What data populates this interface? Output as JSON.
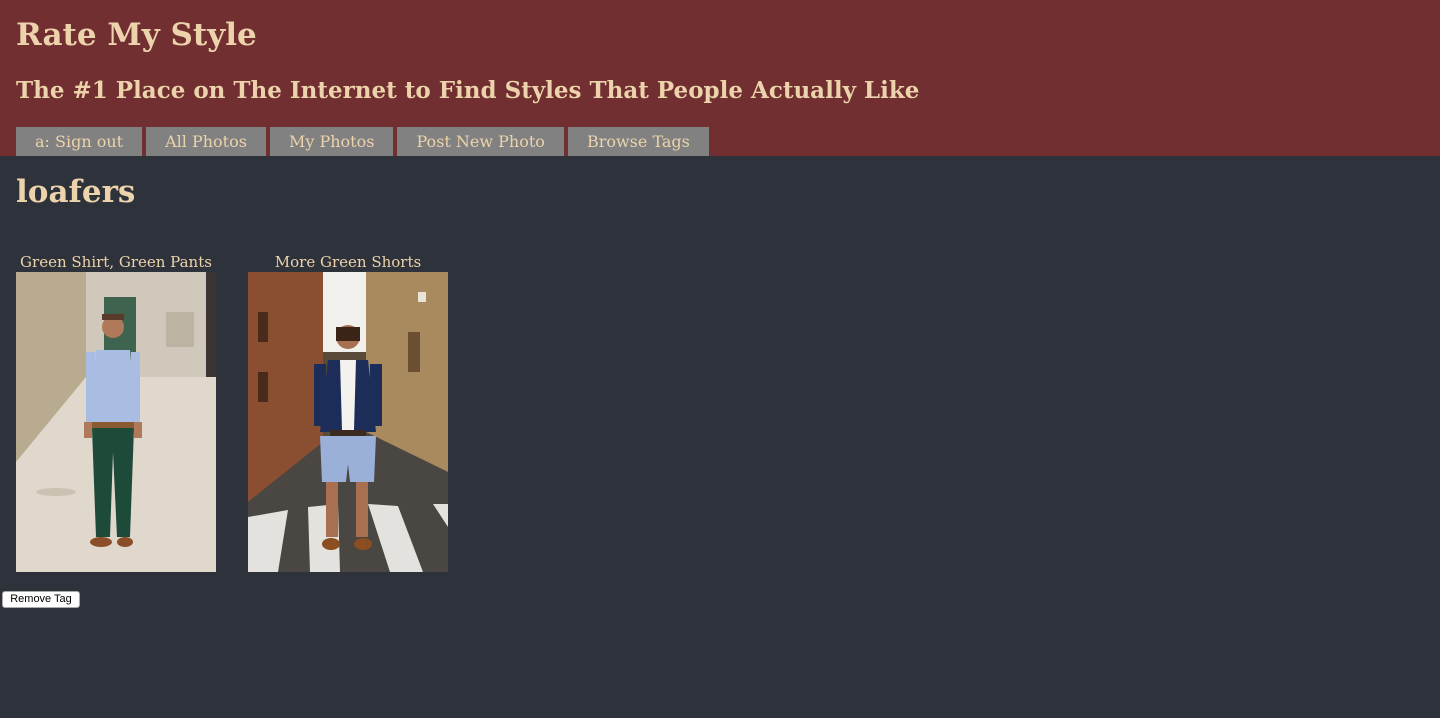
{
  "header": {
    "title": "Rate My Style",
    "tagline": "The #1 Place on The Internet to Find Styles That People Actually Like"
  },
  "nav": {
    "items": [
      {
        "label": "a: Sign out"
      },
      {
        "label": "All Photos"
      },
      {
        "label": "My Photos"
      },
      {
        "label": "Post New Photo"
      },
      {
        "label": "Browse Tags"
      }
    ]
  },
  "tag": {
    "name": "loafers"
  },
  "photos": [
    {
      "title": "Green Shirt, Green Pants"
    },
    {
      "title": "More Green Shorts"
    }
  ],
  "actions": {
    "remove_tag_label": "Remove Tag"
  },
  "colors": {
    "header_bg": "#712f31",
    "page_bg": "#2e323b",
    "text_accent": "#ecd3ab",
    "nav_bg": "#808180"
  }
}
